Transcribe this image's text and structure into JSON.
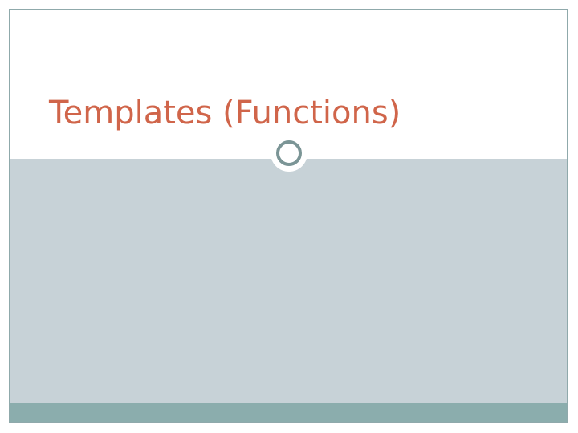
{
  "slide": {
    "title": "Templates (Functions)"
  },
  "theme": {
    "title_color": "#d0654a",
    "panel_color": "#c7d2d7",
    "footer_color": "#8badad",
    "ring_color": "#7b9596",
    "border_color": "#8fa9ab"
  }
}
